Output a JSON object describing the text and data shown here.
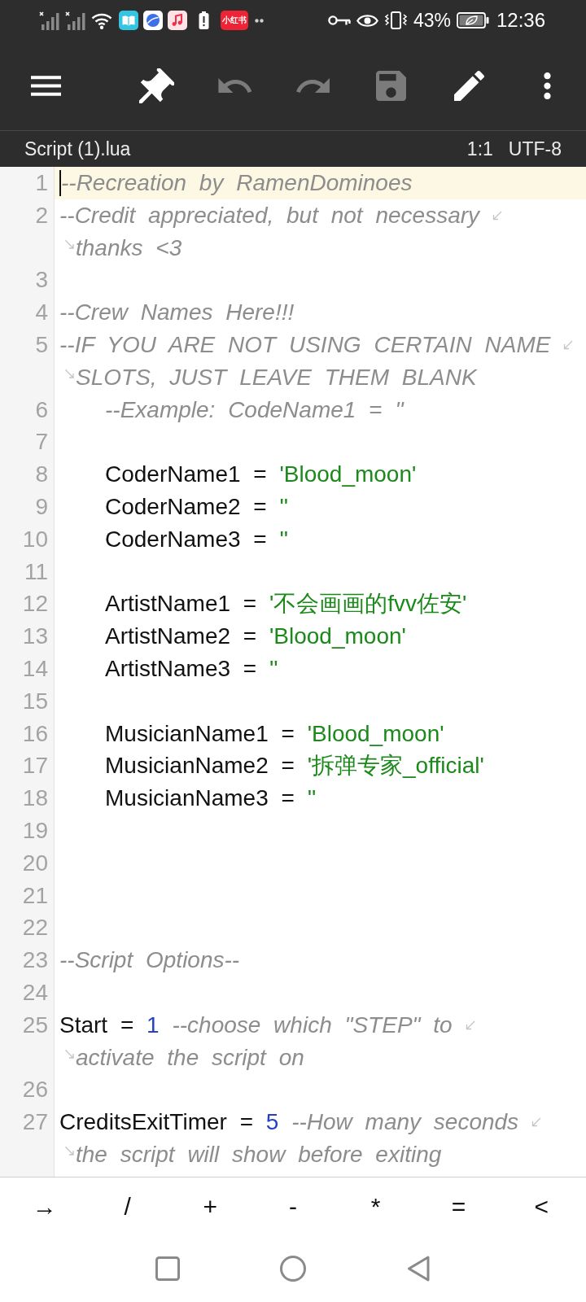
{
  "status_bar": {
    "app_label": "小红书",
    "battery": "43%",
    "time": "12:36"
  },
  "toolbar": {
    "buttons": [
      {
        "kind": "menu",
        "disabled": false
      },
      {
        "kind": "pin",
        "disabled": false
      },
      {
        "kind": "undo",
        "disabled": true
      },
      {
        "kind": "redo",
        "disabled": true
      },
      {
        "kind": "save",
        "disabled": true
      },
      {
        "kind": "edit",
        "disabled": false
      },
      {
        "kind": "more",
        "disabled": false
      }
    ]
  },
  "file_bar": {
    "file_name": "Script (1).lua",
    "cursor_position": "1:1",
    "encoding": "UTF-8"
  },
  "editor": {
    "lines": [
      {
        "number": "1",
        "current": true,
        "indented": false,
        "rows": [
          [
            {
              "kind": "comment",
              "text": "--Recreation by RamenDominoes"
            }
          ]
        ]
      },
      {
        "number": "2",
        "current": false,
        "indented": false,
        "rows": [
          [
            {
              "kind": "comment",
              "text": "--Credit appreciated, but not necessary"
            }
          ],
          [
            {
              "kind": "comment",
              "text": "thanks <3"
            }
          ]
        ]
      },
      {
        "number": "3",
        "current": false
      },
      {
        "number": "4",
        "current": false,
        "indented": false,
        "rows": [
          [
            {
              "kind": "comment",
              "text": "--Crew Names Here!!!"
            }
          ]
        ]
      },
      {
        "number": "5",
        "current": false,
        "indented": false,
        "rows": [
          [
            {
              "kind": "comment",
              "text": "--IF YOU ARE NOT USING CERTAIN NAME"
            }
          ],
          [
            {
              "kind": "comment",
              "text": "SLOTS, JUST LEAVE THEM BLANK"
            }
          ]
        ]
      },
      {
        "number": "6",
        "current": false,
        "indented": true,
        "rows": [
          [
            {
              "kind": "comment",
              "text": "--Example: CodeName1 = ''"
            }
          ]
        ]
      },
      {
        "number": "7",
        "current": false
      },
      {
        "number": "8",
        "current": false,
        "indented": true,
        "rows": [
          [
            {
              "kind": "code",
              "text": "CoderName1 = "
            },
            {
              "kind": "string",
              "text": "'Blood_moon'"
            }
          ]
        ]
      },
      {
        "number": "9",
        "current": false,
        "indented": true,
        "rows": [
          [
            {
              "kind": "code",
              "text": "CoderName2 = "
            },
            {
              "kind": "string",
              "text": "''"
            }
          ]
        ]
      },
      {
        "number": "10",
        "current": false,
        "indented": true,
        "rows": [
          [
            {
              "kind": "code",
              "text": "CoderName3 = "
            },
            {
              "kind": "string",
              "text": "''"
            }
          ]
        ]
      },
      {
        "number": "11",
        "current": false
      },
      {
        "number": "12",
        "current": false,
        "indented": true,
        "rows": [
          [
            {
              "kind": "code",
              "text": "ArtistName1 = "
            },
            {
              "kind": "string",
              "text": "'不会画画的fvv佐安'"
            }
          ]
        ]
      },
      {
        "number": "13",
        "current": false,
        "indented": true,
        "rows": [
          [
            {
              "kind": "code",
              "text": "ArtistName2 = "
            },
            {
              "kind": "string",
              "text": "'Blood_moon'"
            }
          ]
        ]
      },
      {
        "number": "14",
        "current": false,
        "indented": true,
        "rows": [
          [
            {
              "kind": "code",
              "text": "ArtistName3 = "
            },
            {
              "kind": "string",
              "text": "''"
            }
          ]
        ]
      },
      {
        "number": "15",
        "current": false
      },
      {
        "number": "16",
        "current": false,
        "indented": true,
        "rows": [
          [
            {
              "kind": "code",
              "text": "MusicianName1 = "
            },
            {
              "kind": "string",
              "text": "'Blood_moon'"
            }
          ]
        ]
      },
      {
        "number": "17",
        "current": false,
        "indented": true,
        "rows": [
          [
            {
              "kind": "code",
              "text": "MusicianName2 = "
            },
            {
              "kind": "string",
              "text": "'拆弹专家_official'"
            }
          ]
        ]
      },
      {
        "number": "18",
        "current": false,
        "indented": true,
        "rows": [
          [
            {
              "kind": "code",
              "text": "MusicianName3 = "
            },
            {
              "kind": "string",
              "text": "''"
            }
          ]
        ]
      },
      {
        "number": "19",
        "current": false
      },
      {
        "number": "20",
        "current": false
      },
      {
        "number": "21",
        "current": false
      },
      {
        "number": "22",
        "current": false
      },
      {
        "number": "23",
        "current": false,
        "indented": false,
        "rows": [
          [
            {
              "kind": "comment",
              "text": "--Script Options--"
            }
          ]
        ]
      },
      {
        "number": "24",
        "current": false
      },
      {
        "number": "25",
        "current": false,
        "indented": false,
        "rows": [
          [
            {
              "kind": "code",
              "text": "Start = "
            },
            {
              "kind": "number",
              "text": "1"
            },
            {
              "kind": "comment",
              "text": " --choose which \"STEP\" to"
            }
          ],
          [
            {
              "kind": "comment",
              "text": "activate the script on"
            }
          ]
        ]
      },
      {
        "number": "26",
        "current": false
      },
      {
        "number": "27",
        "current": false,
        "indented": false,
        "rows": [
          [
            {
              "kind": "code",
              "text": "CreditsExitTimer = "
            },
            {
              "kind": "number",
              "text": "5"
            },
            {
              "kind": "comment",
              "text": " --How many seconds"
            }
          ],
          [
            {
              "kind": "comment",
              "text": "the script will show before exiting"
            }
          ]
        ]
      }
    ]
  },
  "symbol_keys": [
    "→",
    "/",
    "+",
    "-",
    "*",
    "=",
    "<"
  ]
}
